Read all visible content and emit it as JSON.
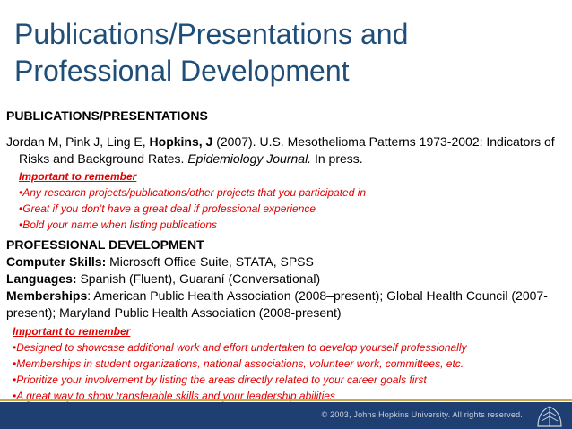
{
  "title": {
    "line1": "Publications/Presentations and",
    "line2": "Professional Development"
  },
  "publications": {
    "heading": "PUBLICATIONS/PRESENTATIONS",
    "citation": {
      "authors_before": "Jordan M, Pink J, Ling E, ",
      "authors_bold": "Hopkins, J",
      "rest": " (2007). U.S. Mesothelioma Patterns 1973-2002:  Indicators of Risks and Background Rates. ",
      "journal": "Epidemiology Journal.",
      "status": " In press."
    },
    "notes": {
      "heading": "Important to remember",
      "items": [
        "•Any research projects/publications/other projects that you participated in",
        "•Great if you don’t have a great deal if professional experience",
        "•Bold your name when listing publications"
      ]
    }
  },
  "professional": {
    "heading": "PROFESSIONAL DEVELOPMENT",
    "computer_label": "Computer Skills:",
    "computer_value": " Microsoft Office Suite, STATA, SPSS",
    "languages_label": "Languages:",
    "languages_value": " Spanish (Fluent), Guaraní (Conversational)",
    "memberships_label": "Memberships",
    "memberships_value": ": American Public Health Association (2008–present); Global Health Council (2007-present); Maryland Public Health Association (2008-present)",
    "notes": {
      "heading": "Important to remember",
      "items": [
        "•Designed to showcase additional work and effort undertaken to develop yourself professionally",
        "•Memberships in student organizations, national associations, volunteer work, committees, etc.",
        "•Prioritize your involvement by listing the areas directly related to your career goals first",
        "•A great way to show transferable skills and your leadership abilities"
      ]
    }
  },
  "footer": {
    "copyright": "© 2003, Johns Hopkins University. All rights reserved."
  },
  "colors": {
    "title": "#1f4e79",
    "notes": "#e00000",
    "footer": "#1f3f73",
    "footer_accent": "#c9a94a"
  }
}
